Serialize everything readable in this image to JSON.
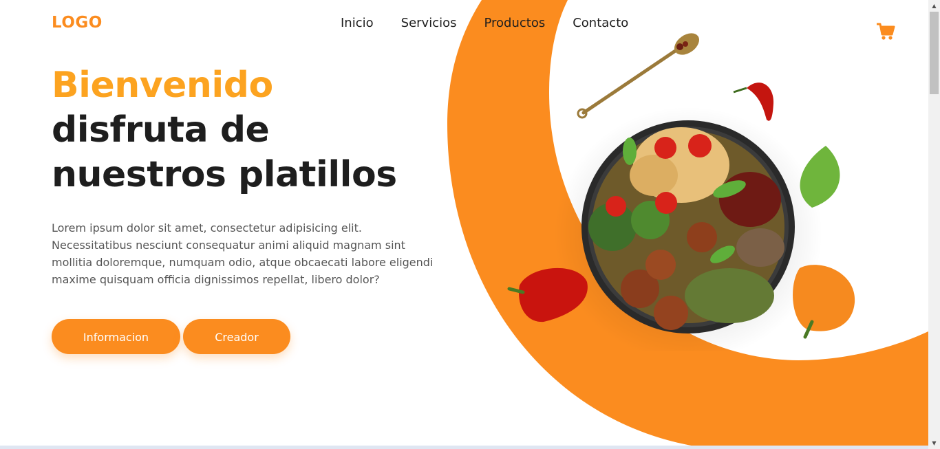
{
  "header": {
    "logo": "LOGO",
    "nav": [
      "Inicio",
      "Servicios",
      "Productos",
      "Contacto"
    ],
    "cart_icon": "shopping-cart-icon"
  },
  "hero": {
    "accent_title": "Bienvenido",
    "title_line1": "disfruta de",
    "title_line2": "nuestros platillos",
    "description": "Lorem ipsum dolor sit amet, consectetur adipisicing elit. Necessitatibus nesciunt consequatur animi aliquid magnam sint mollitia doloremque, numquam odio, atque obcaecati labore eligendi maxime quisquam officia dignissimos repellat, libero dolor?",
    "buttons": {
      "info": "Informacion",
      "creator": "Creador"
    }
  },
  "colors": {
    "accent": "#fb8c1f",
    "accent_light": "#fca320",
    "text_dark": "#1e1e1e",
    "text_muted": "#555555"
  }
}
